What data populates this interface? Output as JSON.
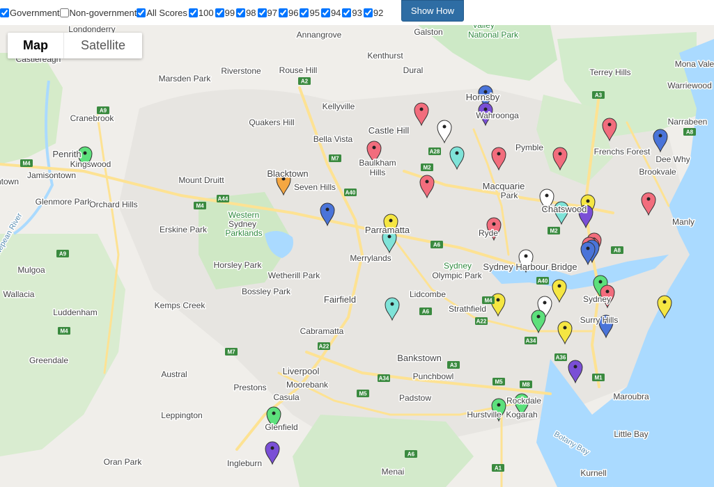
{
  "filters": {
    "checkboxes": [
      {
        "label": "Government",
        "checked": true
      },
      {
        "label": "Non-government",
        "checked": false
      },
      {
        "label": "All Scores",
        "checked": true
      },
      {
        "label": "100",
        "checked": true
      },
      {
        "label": "99",
        "checked": true
      },
      {
        "label": "98",
        "checked": true
      },
      {
        "label": "97",
        "checked": true
      },
      {
        "label": "96",
        "checked": true
      },
      {
        "label": "95",
        "checked": true
      },
      {
        "label": "94",
        "checked": true
      },
      {
        "label": "93",
        "checked": true
      },
      {
        "label": "92",
        "checked": true
      }
    ],
    "button_label": "Show How"
  },
  "map_type": {
    "map_label": "Map",
    "satellite_label": "Satellite",
    "selected": "Map"
  },
  "colors": {
    "land": "#f0eeea",
    "urban": "#e5e3df",
    "water": "#aadaff",
    "park": "#cde9c6",
    "motorway": "#fde293",
    "road": "#ffffff",
    "shield": "#3a8a3f",
    "pin_red": "#f26d7d",
    "pin_blue": "#4a74d9",
    "pin_purple": "#7a4fd6",
    "pin_green": "#5de07c",
    "pin_yellow": "#f5e642",
    "pin_cyan": "#7fe3d8",
    "pin_white": "#ffffff",
    "pin_orange": "#f5a742"
  },
  "places": [
    "Londonderry",
    "Annangrove",
    "Galston",
    "Valley",
    "National Park",
    "Kenthurst",
    "Mona Vale",
    "Castlereagh",
    "Riverstone",
    "Rouse Hill",
    "Dural",
    "Terrey Hills",
    "Marsden Park",
    "Warriewood",
    "Hornsby",
    "Kellyville",
    "Narrabeen",
    "Cranebrook",
    "Quakers Hill",
    "Wahroonga",
    "Castle Hill",
    "Bella Vista",
    "Penrith",
    "Pymble",
    "Frenchs Forest",
    "Kingswood",
    "Baulkham",
    "Hills",
    "Dee Why",
    "Blacktown",
    "Jamisontown",
    "Mount Druitt",
    "Seven Hills",
    "Brookvale",
    "Macquarie",
    "Park",
    "Glenmore Park",
    "Orchard Hills",
    "Chatswood",
    "Western",
    "Sydney",
    "Parklands",
    "Manly",
    "Erskine Park",
    "Parramatta",
    "Ryde",
    "Merrylands",
    "Sydney Harbour Bridge",
    "Horsley Park",
    "Sydney",
    "Olympic Park",
    "Mulgoa",
    "Wetherill Park",
    "Bossley Park",
    "Lidcombe",
    "Wallacia",
    "Fairfield",
    "Sydney",
    "Kemps Creek",
    "Luddenham",
    "Strathfield",
    "Surry Hills",
    "Cabramatta",
    "Bankstown",
    "Greendale",
    "Austral",
    "Liverpool",
    "Moorebank",
    "Punchbowl",
    "Prestons",
    "Padstow",
    "Casula",
    "Rockdale",
    "Maroubra",
    "Leppington",
    "Hurstville",
    "Kogarah",
    "Glenfield",
    "Little Bay",
    "Botany Bay",
    "Oran Park",
    "Ingleburn",
    "Menai",
    "Kurnell",
    "Nepean River",
    "Jamisontown"
  ],
  "road_shields": [
    "A9",
    "A2",
    "A3",
    "A8",
    "M4",
    "M7",
    "A28",
    "M2",
    "A40",
    "A44",
    "M4",
    "A6",
    "A40",
    "M2",
    "A8",
    "M4",
    "A22",
    "A6",
    "A34",
    "A36",
    "M1",
    "A34",
    "M5",
    "M8",
    "M7",
    "A22",
    "A3",
    "M5",
    "A9",
    "A6",
    "A1",
    "M4"
  ],
  "schools": {
    "legend_note": "",
    "pins": [
      {
        "color": "pin_red"
      },
      {
        "color": "pin_white"
      },
      {
        "color": "pin_blue"
      },
      {
        "color": "pin_purple"
      },
      {
        "color": "pin_red"
      },
      {
        "color": "pin_cyan"
      },
      {
        "color": "pin_red"
      },
      {
        "color": "pin_red"
      },
      {
        "color": "pin_red"
      },
      {
        "color": "pin_red"
      },
      {
        "color": "pin_blue"
      },
      {
        "color": "pin_green"
      },
      {
        "color": "pin_orange"
      },
      {
        "color": "pin_red"
      },
      {
        "color": "pin_blue"
      },
      {
        "color": "pin_yellow"
      },
      {
        "color": "pin_cyan"
      },
      {
        "color": "pin_red"
      },
      {
        "color": "pin_white"
      },
      {
        "color": "pin_cyan"
      },
      {
        "color": "pin_yellow"
      },
      {
        "color": "pin_purple"
      },
      {
        "color": "pin_red"
      },
      {
        "color": "pin_red"
      },
      {
        "color": "pin_red"
      },
      {
        "color": "pin_blue"
      },
      {
        "color": "pin_blue"
      },
      {
        "color": "pin_white"
      },
      {
        "color": "pin_green"
      },
      {
        "color": "pin_yellow"
      },
      {
        "color": "pin_red"
      },
      {
        "color": "pin_yellow"
      },
      {
        "color": "pin_yellow"
      },
      {
        "color": "pin_white"
      },
      {
        "color": "pin_green"
      },
      {
        "color": "pin_cyan"
      },
      {
        "color": "pin_yellow"
      },
      {
        "color": "pin_blue"
      },
      {
        "color": "pin_purple"
      },
      {
        "color": "pin_green"
      },
      {
        "color": "pin_green"
      },
      {
        "color": "pin_green"
      },
      {
        "color": "pin_purple"
      }
    ]
  }
}
